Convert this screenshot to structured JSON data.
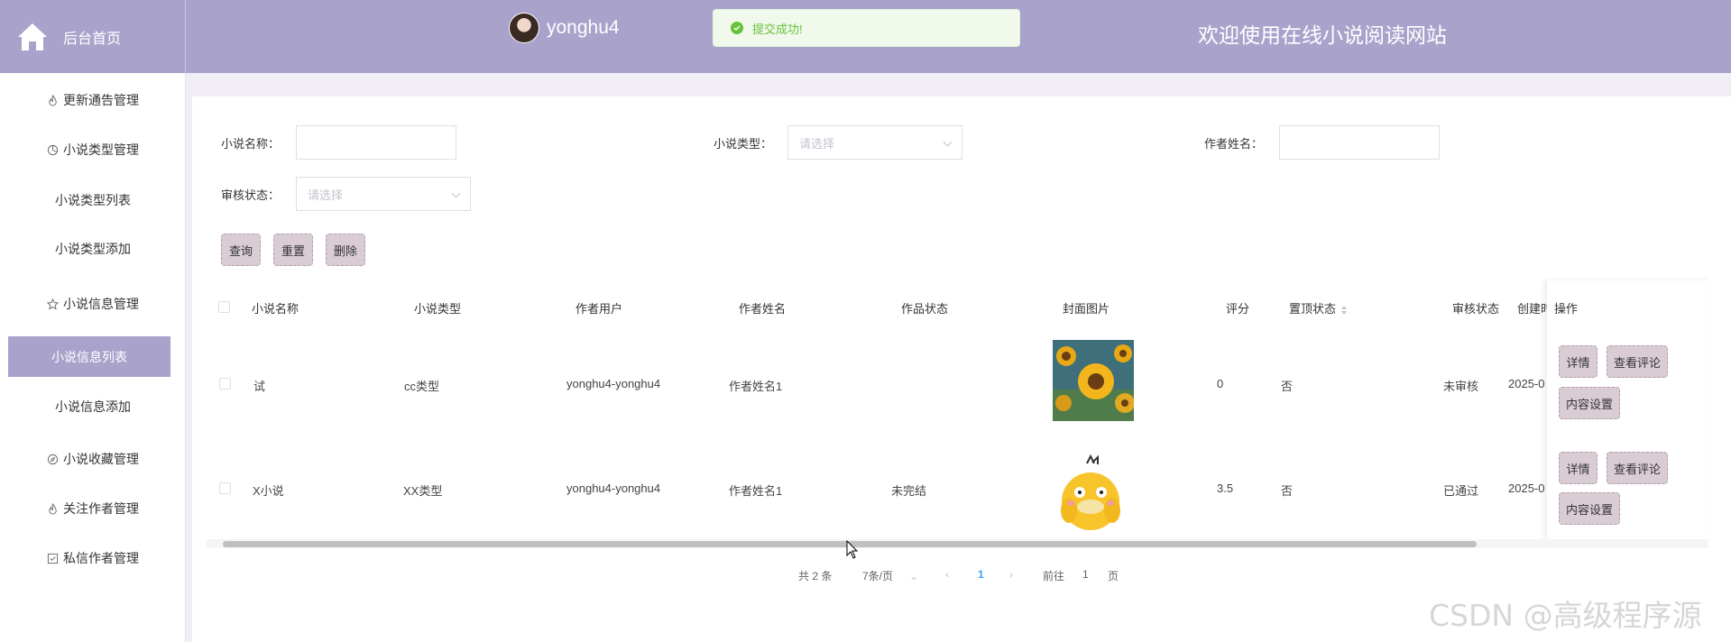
{
  "header": {
    "home_label": "后台首页",
    "username": "yonghu4",
    "toast": "提交成功!",
    "site_title": "欢迎使用在线小说阅读网站"
  },
  "sidebar": {
    "items": [
      {
        "label": "更新通告管理",
        "icon": "flame-icon"
      },
      {
        "label": "小说类型管理",
        "icon": "chart-icon"
      },
      {
        "label": "小说类型列表"
      },
      {
        "label": "小说类型添加"
      },
      {
        "label": "小说信息管理",
        "icon": "star-icon"
      },
      {
        "label": "小说信息列表",
        "active": true
      },
      {
        "label": "小说信息添加"
      },
      {
        "label": "小说收藏管理",
        "icon": "compass-icon"
      },
      {
        "label": "关注作者管理",
        "icon": "flame-icon"
      },
      {
        "label": "私信作者管理",
        "icon": "checkbox-icon"
      }
    ]
  },
  "filters": {
    "name_label": "小说名称：",
    "type_label": "小说类型：",
    "type_placeholder": "请选择",
    "author_label": "作者姓名：",
    "audit_label": "审核状态：",
    "audit_placeholder": "请选择"
  },
  "buttons": {
    "query": "查询",
    "reset": "重置",
    "delete": "删除"
  },
  "table": {
    "columns": [
      "小说名称",
      "小说类型",
      "作者用户",
      "作者姓名",
      "作品状态",
      "封面图片",
      "评分",
      "置顶状态",
      "审核状态",
      "创建时",
      "操作"
    ],
    "rows": [
      {
        "name": "试",
        "type": "cc类型",
        "user": "yonghu4-yonghu4",
        "author": "作者姓名1",
        "status": "",
        "score": "0",
        "top": "否",
        "audit": "未审核",
        "created": "2025-0"
      },
      {
        "name": "X小说",
        "type": "XX类型",
        "user": "yonghu4-yonghu4",
        "author": "作者姓名1",
        "status": "未完结",
        "score": "3.5",
        "top": "否",
        "audit": "已通过",
        "created": "2025-0"
      }
    ],
    "ops": {
      "detail": "详情",
      "comments": "查看评论",
      "content": "内容设置"
    }
  },
  "pagination": {
    "total": "共 2 条",
    "page_size": "7条/页",
    "current": "1",
    "goto_prefix": "前往",
    "goto_value": "1",
    "goto_suffix": "页"
  },
  "watermark": "CSDN @高级程序源",
  "colors": {
    "header": "#a9a3cc",
    "button": "#d9ccd4",
    "success": "#67c23a"
  }
}
